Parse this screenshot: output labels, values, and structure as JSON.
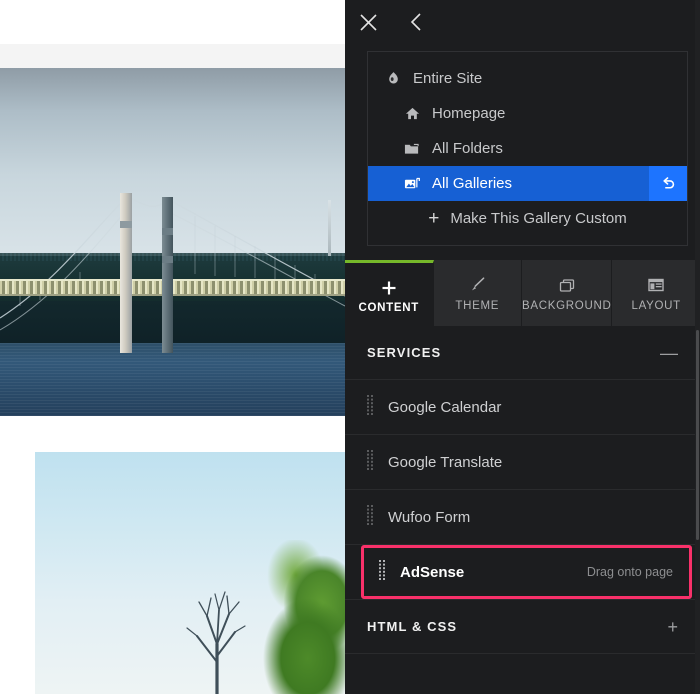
{
  "panel": {
    "header": {
      "close_icon": "close-icon",
      "back_icon": "chevron-left-icon"
    },
    "nav": {
      "items": [
        {
          "label": "Entire Site",
          "icon": "globe-icon",
          "level": 1,
          "selected": false
        },
        {
          "label": "Homepage",
          "icon": "home-icon",
          "level": 2,
          "selected": false
        },
        {
          "label": "All Folders",
          "icon": "folder-icon",
          "level": 2,
          "selected": false
        },
        {
          "label": "All Galleries",
          "icon": "gallery-icon",
          "level": 2,
          "selected": true
        }
      ],
      "custom_action": {
        "label": "Make This Gallery Custom",
        "icon": "plus-icon"
      },
      "undo_icon": "undo-icon",
      "selected_color": "#1660d4",
      "undo_color": "#1d74ff"
    },
    "tabs": [
      {
        "label": "CONTENT",
        "icon": "plus-icon",
        "active": true
      },
      {
        "label": "THEME",
        "icon": "brush-icon",
        "active": false
      },
      {
        "label": "BACKGROUND",
        "icon": "windows-icon",
        "active": false
      },
      {
        "label": "LAYOUT",
        "icon": "layout-icon",
        "active": false
      }
    ],
    "tab_accent_color": "#76b82a",
    "sections": [
      {
        "title": "SERVICES",
        "toggle_icon": "minus-icon",
        "toggle_label": "—",
        "items": [
          {
            "label": "Google Calendar",
            "icon": "drag-handle-icon",
            "highlighted": false,
            "hint": ""
          },
          {
            "label": "Google Translate",
            "icon": "drag-handle-icon",
            "highlighted": false,
            "hint": ""
          },
          {
            "label": "Wufoo Form",
            "icon": "drag-handle-icon",
            "highlighted": false,
            "hint": ""
          },
          {
            "label": "AdSense",
            "icon": "drag-handle-icon",
            "highlighted": true,
            "hint": "Drag onto page"
          }
        ]
      },
      {
        "title": "HTML & CSS",
        "toggle_icon": "plus-icon",
        "toggle_label": "+",
        "items": []
      }
    ],
    "highlight_color": "#f9316a",
    "background_color": "#1c1d1f"
  },
  "preview": {
    "images": [
      {
        "name": "bridge-photo",
        "alt": "Suspension bridge over water at dusk"
      },
      {
        "name": "sky-tree-photo",
        "alt": "Pale blue sky with bare tree and evergreen"
      }
    ]
  }
}
